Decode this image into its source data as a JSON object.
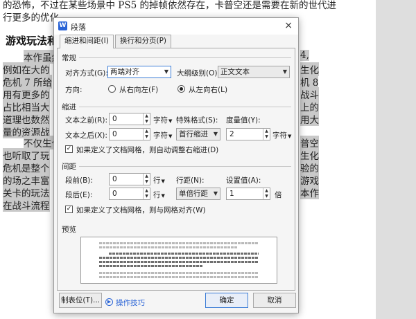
{
  "document": {
    "line1": "的恐怖，不过在某些场景中 PS5 的掉帧依然存在，卡普空还是需要在新的世代进",
    "line2": "行更多的优化",
    "heading": "游戏玩法和",
    "left_frag": [
      "本作虽然",
      "例如在大的",
      "危机 7 所给",
      "用有更多的",
      "占比相当大",
      "道理也数然",
      "量的资源战"
    ],
    "right_frag": [
      "4,",
      "生化",
      "机 8",
      "战斗",
      "上的",
      "用大"
    ],
    "left_frag2": [
      "不仅生化",
      "也听取了玩",
      "危机是整个",
      "的场之丰富",
      "关卡的玩法",
      "在战斗流程"
    ],
    "right_frag2": [
      "普空",
      "生化",
      "验的",
      "游戏",
      "本作"
    ]
  },
  "dialog": {
    "title": "段落",
    "close": "×",
    "tabs": [
      "缩进和间距(I)",
      "换行和分页(P)"
    ],
    "general": {
      "section": "常规",
      "align_label": "对齐方式(G):",
      "align_value": "两端对齐",
      "outline_label": "大纲级别(O):",
      "outline_value": "正文文本",
      "direction_label": "方向:",
      "rtl_label": "从右向左(F)",
      "ltr_label": "从左向右(L)"
    },
    "indent": {
      "section": "缩进",
      "before_label": "文本之前(R):",
      "before_value": "0",
      "after_label": "文本之后(X):",
      "after_value": "0",
      "unit": "字符",
      "special_label": "特殊格式(S):",
      "special_value": "首行缩进",
      "measure_label": "度量值(Y):",
      "measure_value": "2",
      "grid_check": "如果定义了文档网格，则自动调整右缩进(D)"
    },
    "spacing": {
      "section": "间距",
      "before_label": "段前(B):",
      "before_value": "0",
      "after_label": "段后(E):",
      "after_value": "0",
      "unit": "行",
      "line_label": "行距(N):",
      "line_value": "单倍行距",
      "set_label": "设置值(A):",
      "set_value": "1",
      "set_unit": "倍",
      "grid_check": "如果定义了文档网格，则与网格对齐(W)"
    },
    "preview": {
      "section": "预览"
    },
    "buttons": {
      "tabs": "制表位(T)...",
      "tips": "操作技巧",
      "ok": "确定",
      "cancel": "取消"
    }
  }
}
